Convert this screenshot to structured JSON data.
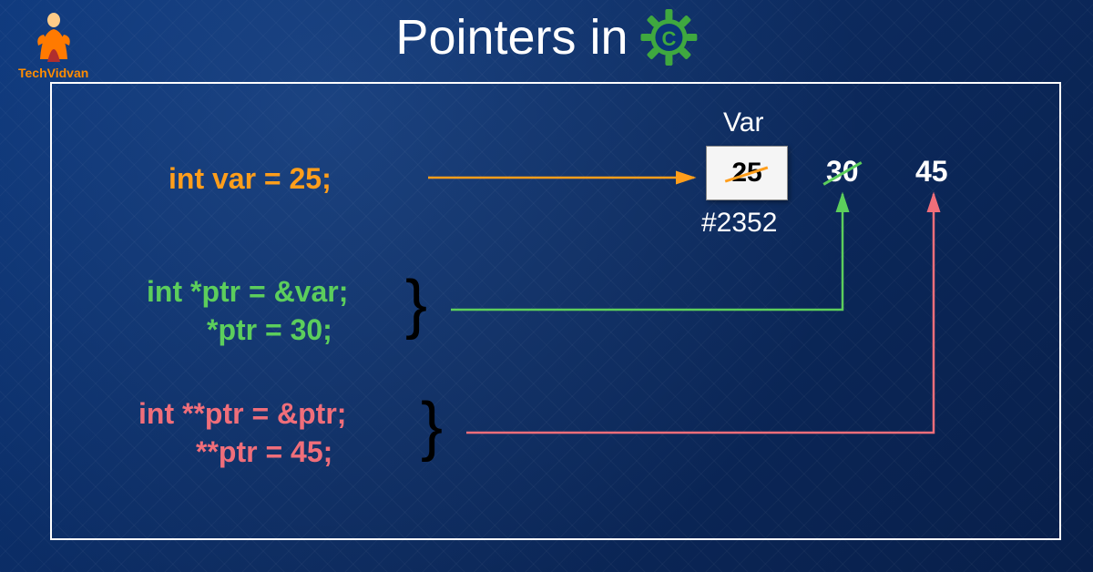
{
  "header": {
    "title": "Pointers in",
    "gear_letter": "C",
    "logo_name": "TechVidvan"
  },
  "code": {
    "line1": "int var = 25;",
    "line2a": "int *ptr = &var;",
    "line2b": "*ptr = 30;",
    "line3a": "int **ptr = &ptr;",
    "line3b": "**ptr = 45;"
  },
  "memory": {
    "var_label": "Var",
    "var_value": "25",
    "var_address": "#2352",
    "next_value_1": "30",
    "next_value_2": "45"
  },
  "colors": {
    "orange": "#ff9e1b",
    "green": "#5cce5c",
    "salmon": "#f06e7a",
    "bg_start": "#0a3478",
    "bg_end": "#081f4a"
  }
}
